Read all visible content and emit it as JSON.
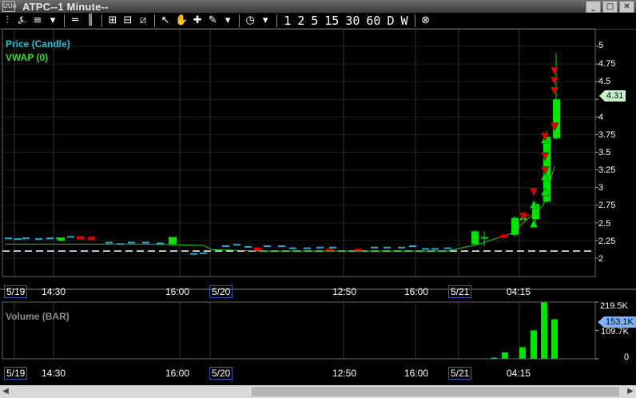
{
  "window": {
    "title": "ATPC--1 Minute--",
    "app_icon_text": "UUo",
    "minimize_label": "_",
    "maximize_label": "□",
    "close_label": "✕"
  },
  "toolbar": {
    "icons": [
      "chart-style-icon",
      "studies-icon",
      "lines-icon",
      "dropdown-arrow-icon",
      "horizontal-line-icon",
      "vertical-line-icon",
      "crosshair-box-icon",
      "split-pane-icon",
      "template-icon",
      "pointer-icon",
      "hand-icon",
      "crosshair-icon",
      "pencil-icon",
      "dropdown-arrow-icon",
      "clock-icon",
      "dropdown-arrow-icon"
    ],
    "intervals": [
      "1",
      "2",
      "5",
      "15",
      "30",
      "60",
      "D",
      "W"
    ],
    "close_icon": "cancel-icon"
  },
  "price_pane": {
    "legend_price": "Price (Candle)",
    "legend_vwap": "VWAP (0)",
    "y_ticks": [
      "5",
      "4.75",
      "4.5",
      "4.25",
      "4",
      "3.75",
      "3.5",
      "3.25",
      "3",
      "2.75",
      "2.5",
      "2.25",
      "2"
    ],
    "last_price": "4.31",
    "x_labels": [
      "5/19",
      "14:30",
      "16:00",
      "5/20",
      "12:50",
      "16:00",
      "5/21",
      "04:15"
    ]
  },
  "volume_pane": {
    "legend": "Volume (BAR)",
    "y_ticks": [
      "219.5K",
      "109.7K",
      "0"
    ],
    "last_volume": "153.1K",
    "x_labels": [
      "5/19",
      "14:30",
      "16:00",
      "5/20",
      "12:50",
      "16:00",
      "5/21",
      "04:15"
    ]
  },
  "colors": {
    "up": "#00e400",
    "down": "#e40000",
    "vwap": "#1fd21f",
    "prior_bars": "#29a9d6",
    "grid": "#333333",
    "ref_line": "#ffffff"
  },
  "chart_data": {
    "type": "candlestick",
    "price_ylim": [
      2,
      5
    ],
    "volume_ylim": [
      0,
      219.5
    ],
    "volume_units": "K",
    "reference_line_price": 2.1,
    "late_candles": [
      {
        "open": 2.2,
        "close": 2.38,
        "high": 2.4,
        "low": 2.18,
        "dir": "up"
      },
      {
        "open": 2.3,
        "close": 2.3,
        "high": 2.38,
        "low": 2.17,
        "dir": "up"
      },
      {
        "open": 2.33,
        "close": 2.29,
        "high": 2.35,
        "low": 2.27,
        "dir": "down"
      },
      {
        "open": 2.33,
        "close": 2.57,
        "high": 2.6,
        "low": 2.3,
        "dir": "up"
      },
      {
        "open": 2.62,
        "close": 2.6,
        "high": 2.63,
        "low": 2.57,
        "dir": "down"
      },
      {
        "open": 2.55,
        "close": 2.77,
        "high": 2.8,
        "low": 2.45,
        "dir": "up"
      },
      {
        "open": 2.8,
        "close": 3.72,
        "high": 3.8,
        "low": 2.78,
        "dir": "up"
      },
      {
        "open": 3.7,
        "close": 4.25,
        "high": 4.9,
        "low": 3.68,
        "dir": "up"
      }
    ],
    "late_volumes": [
      0,
      0,
      5,
      25,
      45,
      110,
      219.5,
      153.1
    ]
  }
}
